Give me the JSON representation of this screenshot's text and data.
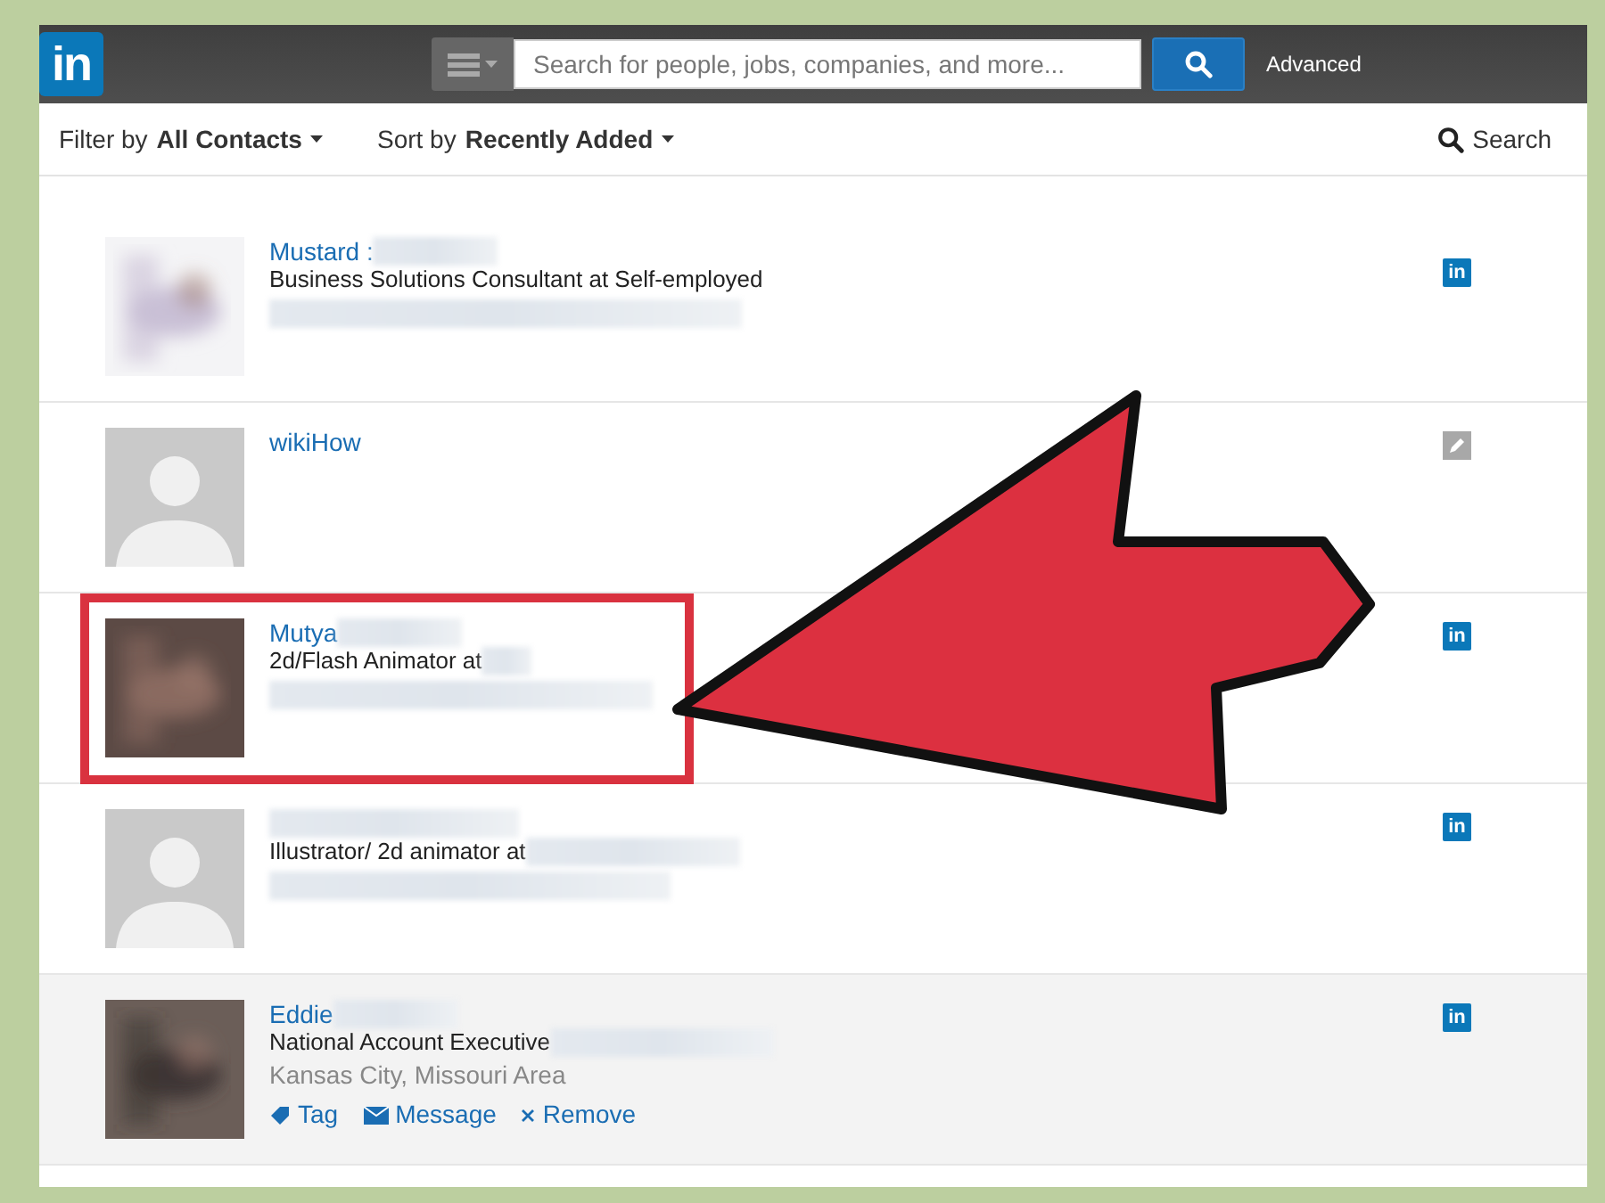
{
  "header": {
    "logo": "in",
    "search": {
      "placeholder": "Search for people, jobs, companies, and more..."
    },
    "advanced": "Advanced"
  },
  "toolbar": {
    "filter_label": "Filter by",
    "filter_value": "All Contacts",
    "sort_label": "Sort by",
    "sort_value": "Recently Added",
    "search": "Search"
  },
  "contacts": [
    {
      "name": "Mustard :",
      "name_blurred": true,
      "headline": "Business Solutions Consultant at Self-employed",
      "detail_blurred": true,
      "source": {
        "kind": "linkedin",
        "label": "in"
      },
      "highlighted": false,
      "hovered": false
    },
    {
      "name": "wikiHow",
      "name_blurred": false,
      "avatar": {
        "kind": "placeholder"
      },
      "source": {
        "kind": "edit"
      },
      "highlighted": false,
      "hovered": false
    },
    {
      "name": "Mutya",
      "name_blurred": true,
      "headline": "2d/Flash Animator at",
      "detail_blurred": true,
      "source": {
        "kind": "linkedin",
        "label": "in"
      },
      "highlighted": true,
      "hovered": false
    },
    {
      "name_blurred": true,
      "headline": "Illustrator/ 2d animator at",
      "detail_blurred": true,
      "avatar": {
        "kind": "placeholder"
      },
      "source": {
        "kind": "linkedin",
        "label": "in"
      },
      "highlighted": false,
      "hovered": false
    },
    {
      "name": "Eddie",
      "name_blurred": true,
      "headline": "National Account Executive",
      "detail_blurred": true,
      "location": "Kansas City, Missouri Area",
      "source": {
        "kind": "linkedin",
        "label": "in"
      },
      "highlighted": false,
      "hovered": true,
      "actions": [
        {
          "kind": "tag",
          "label": "Tag"
        },
        {
          "kind": "message",
          "label": "Message"
        },
        {
          "kind": "remove",
          "label": "Remove"
        }
      ]
    }
  ]
}
